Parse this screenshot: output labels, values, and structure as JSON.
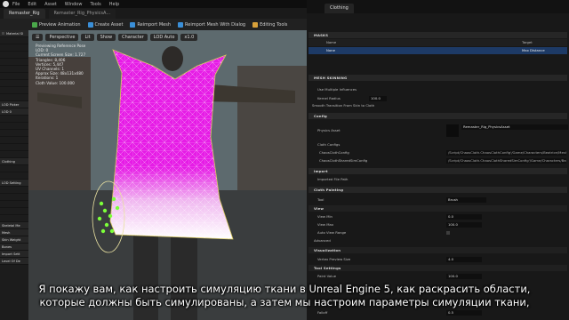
{
  "menubar": {
    "items": [
      "File",
      "Edit",
      "Asset",
      "Window",
      "Tools",
      "Help"
    ]
  },
  "tabs": [
    {
      "label": "Remaster_Rig"
    },
    {
      "label": "Remaster_Rig_PhysicsA..."
    }
  ],
  "toolbar": {
    "buttons": [
      {
        "label": "Preview Animation",
        "icon": "play-icon"
      },
      {
        "label": "Create Asset",
        "icon": "plus-icon"
      },
      {
        "label": "Reimport Mesh",
        "icon": "refresh-icon"
      },
      {
        "label": "Reimport Mesh With Dialog",
        "icon": "refresh-icon"
      },
      {
        "label": "Editing Tools",
        "icon": "brush-icon"
      }
    ]
  },
  "left_panel": {
    "rows": [
      "Material Sl",
      "LOD Picker",
      "LOD 0",
      "Clothing",
      "LOD Setting",
      "Skeletal Me",
      "Mesh",
      "Skin Weight",
      "Bones",
      "Import Sett",
      "Level Of De"
    ]
  },
  "viewport": {
    "buttons": [
      "Perspective",
      "Lit",
      "Show",
      "Character",
      "LOD Auto",
      "x1.0"
    ],
    "stats": [
      "Previewing Reference Pose",
      "LOD: 0",
      "Current Screen Size: 1.727",
      "Triangles: 8,406",
      "Vertices: 5,447",
      "UV Channels: 1",
      "Approx Size: 48x131x480",
      "Iterations: 1",
      "Cloth Value: 100.000"
    ]
  },
  "details": {
    "tab_title": "Clothing",
    "masks_header": "MASKS",
    "masks_columns": [
      "Name",
      "Target"
    ],
    "mask_row": {
      "name": "None",
      "target": "Max Distance"
    },
    "mesh_skinning_header": "MESH SKINNING",
    "use_multiple_influences": "Use Multiple Influences",
    "kernel_radius": {
      "label": "Kernel Radius",
      "value": "100.0"
    },
    "smooth_transition": "Smooth Transition From Skin to Cloth",
    "config_header": "Config",
    "physics_asset": {
      "label": "Physics Asset",
      "value": "Remaster_Rig_PhysicsAsset"
    },
    "cloth_configs": {
      "label": "Cloth Configs",
      "items": [
        {
          "name": "ChaosClothConfig",
          "path": "/Script/ChaosCloth.ChaosClothConfig'/Game/Characters/Beatrice/Mesh/"
        },
        {
          "name": "ChaosClothSharedSimConfig",
          "path": "/Script/ChaosCloth.ChaosClothSharedSimConfig'/Game/Characters/Beatrice/Mesh/"
        }
      ]
    },
    "import_header": "Import",
    "imported_file_path": "Imported File Path",
    "cloth_painting_header": "Cloth Painting",
    "tool": {
      "label": "Tool",
      "value": "Brush"
    },
    "view_header": "View",
    "view_min": {
      "label": "View Min",
      "value": "0.0"
    },
    "view_max": {
      "label": "View Max",
      "value": "100.0"
    },
    "auto_view_range": "Auto View Range",
    "advanced": "Advanced",
    "visualization_header": "Visualization",
    "vertex_preview_size": {
      "label": "Vertex Preview Size",
      "value": "4.0"
    },
    "tool_settings_header": "Tool Settings",
    "paint_value": {
      "label": "Paint Value",
      "value": "100.0"
    },
    "falloff": {
      "label": "Falloff",
      "value": "0.5"
    }
  },
  "subtitles": {
    "line1": "Я покажу вам, как настроить симуляцию ткани в Unreal Engine 5, как раскрасить области,",
    "line2": "которые должны быть симулированы, а затем мы настроим параметры симуляции ткани,"
  },
  "colors": {
    "paint_magenta": "#e61ce6",
    "accent_blue": "#3a8fd8",
    "selection_blue": "#1d3a66",
    "handle_green": "#7cff3a"
  }
}
